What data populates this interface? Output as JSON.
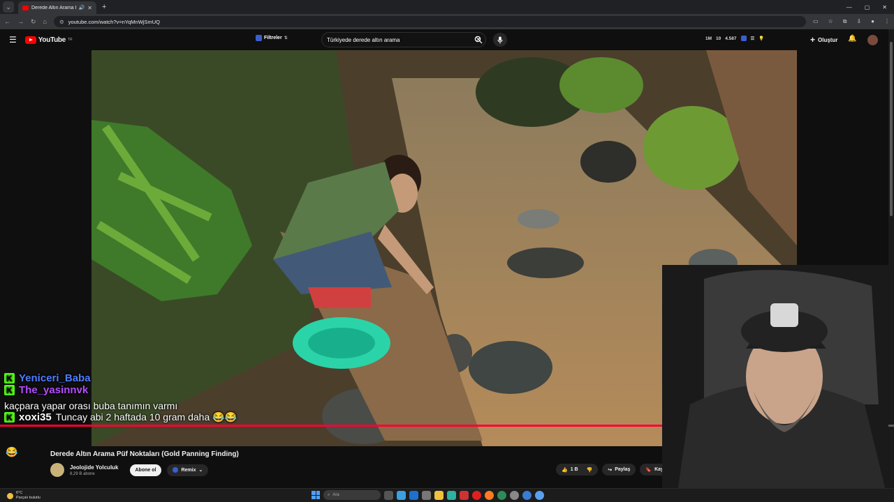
{
  "browser": {
    "tab_title": "Derede Altın Arama Püf No",
    "url": "youtube.com/watch?v=nYqMnWjSmUQ"
  },
  "header": {
    "logo_text": "YouTube",
    "logo_sup": "TR",
    "filters_label": "Filtreler",
    "search_query": "Türkiyede derede altın arama",
    "stats": [
      "1M",
      "10",
      "4.587"
    ],
    "create_label": "Oluştur"
  },
  "chat": [
    {
      "user": "Yeniceri_Baba",
      "message": ""
    },
    {
      "user": "The_yasinnvk",
      "message": "kaçpara yapar orası buba tanımın varmı"
    },
    {
      "user": "xoxi35",
      "message": "Tuncay abi 2 haftada 10 gram daha 😂😂"
    }
  ],
  "video": {
    "title": "Derede Altın Arama Püf Noktaları (Gold Panning Finding)",
    "progress": 0.76,
    "channel_name": "Jeolojide Yolculuk",
    "channel_subs": "8,29 B abone",
    "subscribe_label": "Abone ol",
    "remix_label": "Remix",
    "like_count": "1 B",
    "share_label": "Paylaş",
    "save_label": "Kaydet"
  },
  "taskbar": {
    "temp": "6°C",
    "weather_text": "Parçalı bulutlu",
    "search_placeholder": "Ara"
  }
}
